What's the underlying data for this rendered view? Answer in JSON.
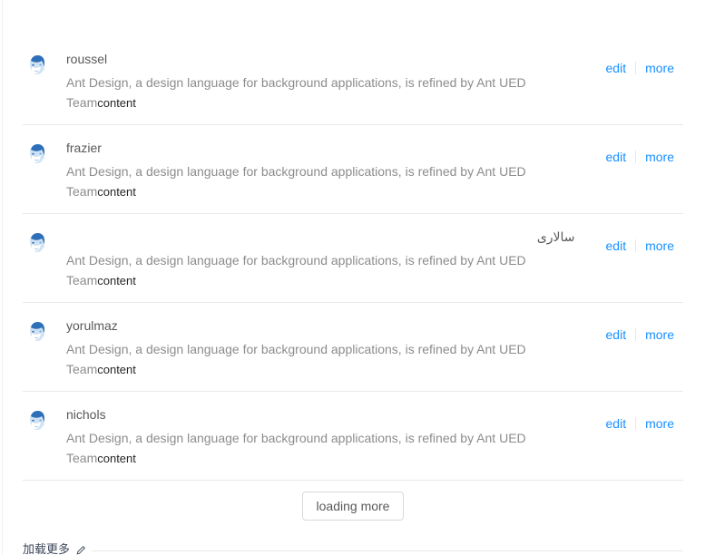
{
  "list": {
    "items": [
      {
        "title": "roussel",
        "description": "Ant Design, a design language for background applications, is refined by Ant UED Team",
        "content": "content",
        "avatar": "user-avatar-icon",
        "actions": {
          "edit": "edit",
          "more": "more"
        }
      },
      {
        "title": "frazier",
        "description": "Ant Design, a design language for background applications, is refined by Ant UED Team",
        "content": "content",
        "avatar": "user-avatar-icon",
        "actions": {
          "edit": "edit",
          "more": "more"
        }
      },
      {
        "title": "سالاری",
        "description": "Ant Design, a design language for background applications, is refined by Ant UED Team",
        "content": "content",
        "avatar": "user-avatar-icon",
        "actions": {
          "edit": "edit",
          "more": "more"
        }
      },
      {
        "title": "yorulmaz",
        "description": "Ant Design, a design language for background applications, is refined by Ant UED Team",
        "content": "content",
        "avatar": "user-avatar-icon",
        "actions": {
          "edit": "edit",
          "more": "more"
        }
      },
      {
        "title": "nichols",
        "description": "Ant Design, a design language for background applications, is refined by Ant UED Team",
        "content": "content",
        "avatar": "user-avatar-icon",
        "actions": {
          "edit": "edit",
          "more": "more"
        }
      }
    ],
    "load_more_label": "loading more"
  },
  "footer": {
    "caption": "加载更多",
    "icon": "pencil-icon"
  },
  "colors": {
    "link": "#1890ff",
    "title": "#595959",
    "description": "#8c8c8c",
    "content": "#262626",
    "border": "#e8e8e8",
    "button_border": "#d9d9d9"
  }
}
